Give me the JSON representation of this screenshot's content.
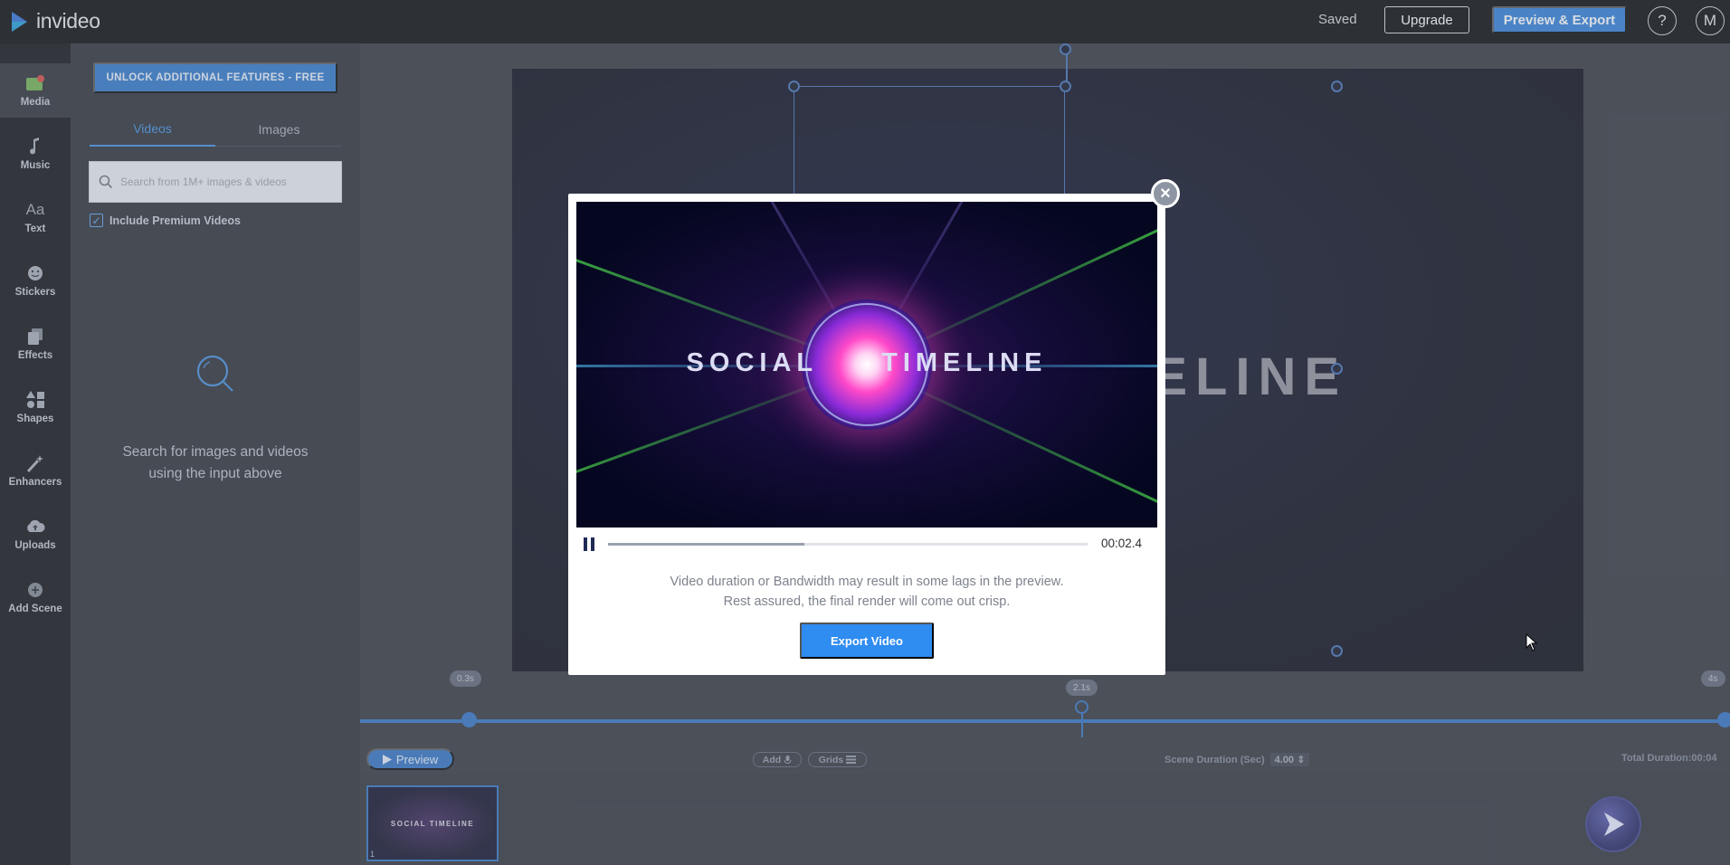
{
  "app": {
    "logo_text": "invideo"
  },
  "header": {
    "saved_label": "Saved",
    "upgrade_label": "Upgrade",
    "preview_export_label": "Preview & Export",
    "help_label": "?",
    "avatar_initial": "M"
  },
  "rail": {
    "items": [
      {
        "label": "Media",
        "icon": "media-icon"
      },
      {
        "label": "Music",
        "icon": "music-note-icon"
      },
      {
        "label": "Text",
        "icon": "text-aa-icon"
      },
      {
        "label": "Stickers",
        "icon": "sticker-icon"
      },
      {
        "label": "Effects",
        "icon": "effects-icon"
      },
      {
        "label": "Shapes",
        "icon": "shapes-icon"
      },
      {
        "label": "Enhancers",
        "icon": "magic-wand-icon"
      },
      {
        "label": "Uploads",
        "icon": "cloud-upload-icon"
      },
      {
        "label": "Add Scene",
        "icon": "plus-circle-icon"
      }
    ],
    "text_icon_glyph": "Aa"
  },
  "panel": {
    "unlock_label": "UNLOCK ADDITIONAL FEATURES - FREE",
    "tabs": [
      {
        "label": "Videos",
        "active": true
      },
      {
        "label": "Images",
        "active": false
      }
    ],
    "search_placeholder": "Search from 1M+ images & videos",
    "premium_label": "Include Premium Videos",
    "premium_checked": true,
    "empty_line1": "Search for images and videos",
    "empty_line2": "using the input above"
  },
  "stage": {
    "title_fragment": "MELINE"
  },
  "timeline": {
    "start_chip": "0.3s",
    "marker_chip": "2.1s",
    "end_chip": "4s",
    "preview_label": "Preview",
    "add_label": "Add",
    "grids_label": "Grids",
    "scene_duration_label": "Scene Duration (Sec)",
    "scene_duration_value": "4.00",
    "total_duration_label": "Total Duration:00:04"
  },
  "scenes": [
    {
      "number": "1",
      "title": "SOCIAL TIMELINE"
    }
  ],
  "modal": {
    "video_title_left": "SOCIAL",
    "video_title_right": "TIMELINE",
    "time_readout": "00:02.4",
    "progress": 0.41,
    "message_line1": "Video duration or Bandwidth may result in some lags in the preview.",
    "message_line2": "Rest assured, the final render will come out crisp.",
    "export_label": "Export Video",
    "close_label": "×"
  },
  "colors": {
    "accent": "#2c7dd8",
    "export_button": "#2f8cf0",
    "selection": "#3b6bb0"
  }
}
